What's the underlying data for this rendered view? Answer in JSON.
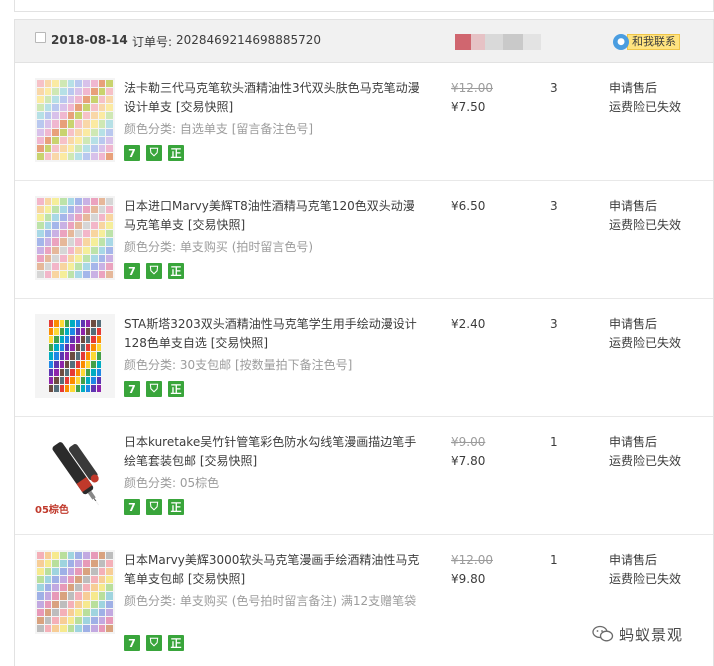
{
  "order": {
    "date": "2018-08-14",
    "order_no_label": "订单号:",
    "order_no": "2028469214698885720",
    "contact_label": "和我联系"
  },
  "items": [
    {
      "title": "法卡勒三代马克笔软头酒精油性3代双头肤色马克笔动漫设计单支",
      "snapshot": "[交易快照]",
      "sku_label": "颜色分类:",
      "sku_value": "自选单支",
      "sku_note": "[留言备注色号]",
      "original_price": "¥12.00",
      "price": "¥7.50",
      "quantity": "3",
      "action_1": "申请售后",
      "action_2": "运费险已失效"
    },
    {
      "title": "日本进口Marvy美辉T8油性酒精马克笔120色双头动漫马克笔单支",
      "snapshot": "[交易快照]",
      "sku_label": "颜色分类:",
      "sku_value": "单支购买",
      "sku_note": "(拍时留言色号)",
      "original_price": "",
      "price": "¥6.50",
      "quantity": "3",
      "action_1": "申请售后",
      "action_2": "运费险已失效"
    },
    {
      "title": "STA斯塔3203双头酒精油性马克笔学生用手绘动漫设计128色单支自选",
      "snapshot": "[交易快照]",
      "sku_label": "颜色分类:",
      "sku_value": "30支包邮",
      "sku_note": "[按数量拍下备注色号]",
      "original_price": "",
      "price": "¥2.40",
      "quantity": "3",
      "action_1": "申请售后",
      "action_2": "运费险已失效"
    },
    {
      "title": "日本kuretake吴竹针管笔彩色防水勾线笔漫画描边笔手绘笔套装包邮",
      "snapshot": "[交易快照]",
      "sku_label": "颜色分类:",
      "sku_value": "05棕色",
      "sku_note": "",
      "original_price": "¥9.00",
      "price": "¥7.80",
      "quantity": "1",
      "action_1": "申请售后",
      "action_2": "运费险已失效",
      "thumb_caption": "05棕色"
    },
    {
      "title": "日本Marvy美辉3000软头马克笔漫画手绘酒精油性马克笔单支包邮",
      "snapshot": "[交易快照]",
      "sku_label": "颜色分类:",
      "sku_value": "单支购买",
      "sku_note": "(色号拍时留言备注) 满12支赠笔袋",
      "original_price": "¥12.00",
      "price": "¥9.80",
      "quantity": "1",
      "action_1": "申请售后",
      "action_2": "运费险已失效"
    }
  ],
  "badges": {
    "seven_days": "7",
    "shield": "⛉",
    "genuine": "正"
  },
  "watermark": {
    "text": "蚂蚁景观"
  },
  "colors": {
    "header_bg": "#f1f1f1",
    "border": "#e2e2e2",
    "badge_green": "#39a53b",
    "contact_yellow": "#ffe37f",
    "muted_text": "#9c9c9c"
  }
}
